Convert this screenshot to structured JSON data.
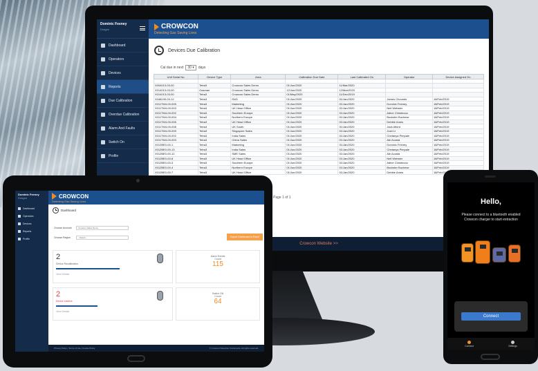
{
  "monitor": {
    "brand": "CROWCON",
    "tagline": "Detecting Gas Saving Lives",
    "user": {
      "name": "Dominic Feeney",
      "role": "Dragon"
    },
    "sidebar": [
      {
        "label": "Dashboard",
        "active": false
      },
      {
        "label": "Operators",
        "active": false
      },
      {
        "label": "Devices",
        "active": false
      },
      {
        "label": "Reports",
        "active": true
      },
      {
        "label": "Due Calibration",
        "active": false
      },
      {
        "label": "Overdue Calibration",
        "active": false
      },
      {
        "label": "Alarm And Faults",
        "active": false
      },
      {
        "label": "Switch On",
        "active": false
      },
      {
        "label": "Profile",
        "active": false
      }
    ],
    "page_title": "Devices Due Calibration",
    "filter": {
      "prefix": "Cal due in next",
      "value": "30",
      "suffix": "days"
    },
    "table": {
      "headers": [
        "Unit Serial No.",
        "Device Type",
        "Area",
        "Calibration Due Date",
        "Last Calibrated On",
        "Operator",
        "Device Assigned On"
      ],
      "rows": [
        [
          "X004013-03-00",
          "Tetra3",
          "Crowcon Sales Demo",
          "01/Jun/2020",
          "11/Mar/2020",
          "",
          ""
        ],
        [
          "X014013-03-00",
          "Gasman",
          "Crowcon Sales Demo",
          "12/Jun/2020",
          "12/Mar/2020",
          "",
          ""
        ],
        [
          "X014013-03-00",
          "Tetra3",
          "Crowcon Sales Demo",
          "01/May/2020",
          "11/Dec/2019",
          "",
          ""
        ],
        [
          "X048249-03-12",
          "Tetra3",
          "R&D",
          "01/Jun/2020",
          "01/Jan/2020",
          "James Chounds",
          "18/Feb/2019"
        ],
        [
          "X011TM4-00-005",
          "Tetra3",
          "Marketing",
          "01/Jun/2020",
          "01/Jan/2020",
          "Dominic Feeney",
          "18/Feb/2019"
        ],
        [
          "X011TM4-00-003",
          "Tetra3",
          "UK Head Office",
          "01/Jun/2020",
          "01/Jan/2020",
          "Neil Webster",
          "18/Feb/2019"
        ],
        [
          "X011TM4-00-002",
          "Tetra3",
          "Southern Europe",
          "01/Jun/2020",
          "01/Jan/2020",
          "Adine Christecca",
          "18/Feb/2019"
        ],
        [
          "X011TM4-00-004",
          "Tetra3",
          "Northern Europe",
          "01/Jun/2020",
          "01/Jan/2020",
          "Bockster Buchese",
          "18/Feb/2019"
        ],
        [
          "X011TM4-00-006",
          "Tetra3",
          "UK Head Office",
          "01/Jun/2020",
          "01/Jan/2020",
          "Debbie Ames",
          "18/Feb/2019"
        ],
        [
          "X011TM4-00-008",
          "Tetra3",
          "UK South",
          "01/Jun/2020",
          "01/Jan/2020",
          "Jack Alford",
          "18/Feb/2019"
        ],
        [
          "X011TM4-00-009",
          "Tetra3",
          "Singapore Sales",
          "01/Jun/2020",
          "01/Jan/2020",
          "Josh Li",
          "18/Feb/2019"
        ],
        [
          "X011TM4-00-002",
          "Tetra3",
          "India Sales",
          "01/Jun/2020",
          "01/Jan/2020",
          "Chetanya Pimpale",
          "18/Feb/2019"
        ],
        [
          "X011TM4-00-003",
          "Tetra3",
          "China Sales",
          "01/Jun/2020",
          "01/Jan/2020",
          "Ale Acosta",
          "18/Feb/2019"
        ],
        [
          "X012BE0-00-1",
          "Tetra3",
          "Marketing",
          "01/Jun/2020",
          "01/Jan/2020",
          "Dominic Feeney",
          "18/Feb/2019"
        ],
        [
          "X012BE0-00-13",
          "Tetra3",
          "India Sales",
          "01/Jun/2020",
          "01/Jan/2020",
          "Chetanya Pimpale",
          "18/Feb/2019"
        ],
        [
          "X012BE0-00-12",
          "Tetra3",
          "SME Sales",
          "01/Jun/2020",
          "01/Jan/2020",
          "Ale Acosta",
          "18/Feb/2019"
        ],
        [
          "X012BE0-00-8",
          "Tetra3",
          "UK Head Office",
          "01/Jun/2020",
          "01/Jan/2020",
          "Neil Webster",
          "18/Feb/2019"
        ],
        [
          "X012BE0-00-3",
          "Tetra3",
          "Southern Europe",
          "01/Jun/2020",
          "01/Jan/2020",
          "Adine Christecca",
          "18/Feb/2019"
        ],
        [
          "X012BE0-00-4",
          "Tetra3",
          "Northern Europe",
          "01/Jun/2020",
          "01/Jan/2020",
          "Bockster Buchese",
          "18/Feb/2019"
        ],
        [
          "X012BE0-00-7",
          "Tetra3",
          "UK Head Office",
          "01/Jun/2020",
          "01/Jan/2020",
          "Debbie Ames",
          "18/Feb/2019"
        ]
      ]
    },
    "pager": "Page 1 of 1",
    "footer_link": "Crowcon Website >>"
  },
  "tablet": {
    "brand": "CROWCON",
    "tagline": "Detecting Gas Saving Lives",
    "user": {
      "name": "Dominic Feeney",
      "role": "Dragon"
    },
    "sidebar": [
      "Dashboard",
      "Operators",
      "Devices",
      "Reports",
      "Profile"
    ],
    "page_title": "Dashboard",
    "filters": [
      {
        "label": "Choose Account",
        "value": "Crowcon Sales Demo"
      },
      {
        "label": "Choose Region",
        "value": "--Select--"
      }
    ],
    "action_button": "Export Dashboard to Excel",
    "cards": [
      {
        "big": "2",
        "label": "Device Recalibration",
        "sub": "View Details"
      },
      {
        "title": "Alarm Events",
        "title2": "Count",
        "value": "115"
      },
      {
        "big": "2",
        "label": "Device Inactive",
        "sub": "View Details"
      },
      {
        "title": "Switch ON",
        "title2": "Count",
        "value": "64"
      }
    ],
    "footer_links": "Privacy Policy | Terms of Use | Cookie Policy",
    "copyright": "© Crowcon Detection Instruments. All rights reserved."
  },
  "phone": {
    "greeting": "Hello,",
    "message": "Please connect to a bluetooth enabled Crowcon charger to start extraction",
    "connect_label": "Connect",
    "nav": [
      "Connect",
      "Settings"
    ]
  }
}
